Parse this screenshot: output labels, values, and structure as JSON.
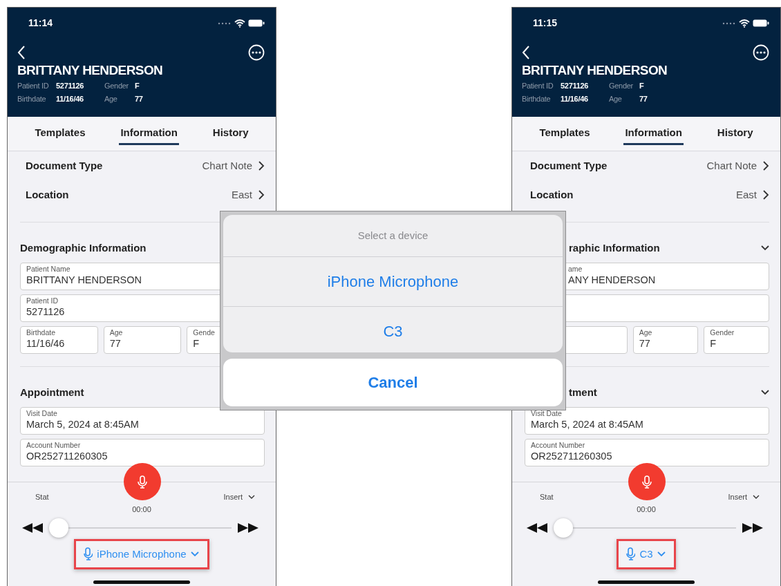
{
  "screens": [
    {
      "status_bar": {
        "time": "11:14"
      },
      "patient": {
        "name": "BRITTANY HENDERSON",
        "meta": [
          {
            "label": "Patient ID",
            "value": "5271126"
          },
          {
            "label": "Gender",
            "value": "F"
          },
          {
            "label": "Birthdate",
            "value": "11/16/46"
          },
          {
            "label": "Age",
            "value": "77"
          }
        ]
      },
      "tabs": [
        {
          "label": "Templates",
          "selected": false
        },
        {
          "label": "Information",
          "selected": true
        },
        {
          "label": "History",
          "selected": false
        }
      ],
      "settings": [
        {
          "label": "Document Type",
          "value": "Chart Note"
        },
        {
          "label": "Location",
          "value": "East"
        }
      ],
      "sections": [
        {
          "title": "Demographic Information",
          "rows": [
            [
              {
                "label": "Patient Name",
                "value": "BRITTANY HENDERSON"
              }
            ],
            [
              {
                "label": "Patient ID",
                "value": "5271126"
              }
            ],
            [
              {
                "label": "Birthdate",
                "value": "11/16/46"
              },
              {
                "label": "Age",
                "value": "77"
              },
              {
                "label": "Gende",
                "value": "F"
              }
            ]
          ]
        },
        {
          "title": "Appointment",
          "rows": [
            [
              {
                "label": "Visit Date",
                "value": "March 5, 2024 at 8:45AM"
              }
            ],
            [
              {
                "label": "Account Number",
                "value": "OR252711260305"
              }
            ]
          ]
        }
      ],
      "recorder": {
        "priority": "Stat",
        "mode": "Insert",
        "elapsed": "00:00",
        "level": 0,
        "device": "iPhone Microphone"
      }
    },
    {
      "status_bar": {
        "time": "11:15"
      },
      "patient": {
        "name": "BRITTANY HENDERSON",
        "meta": [
          {
            "label": "Patient ID",
            "value": "5271126"
          },
          {
            "label": "Gender",
            "value": "F"
          },
          {
            "label": "Birthdate",
            "value": "11/16/46"
          },
          {
            "label": "Age",
            "value": "77"
          }
        ]
      },
      "tabs": [
        {
          "label": "Templates",
          "selected": false
        },
        {
          "label": "Information",
          "selected": true
        },
        {
          "label": "History",
          "selected": false
        }
      ],
      "settings": [
        {
          "label": "Document Type",
          "value": "Chart Note"
        },
        {
          "label": "Location",
          "value": "East"
        }
      ],
      "sections": [
        {
          "title": "raphic Information",
          "covered": true,
          "expanded": true,
          "rows": [
            [
              {
                "label": "ame",
                "value": "ANY HENDERSON",
                "covered": true
              }
            ],
            [
              {
                "covered": true
              }
            ],
            [
              {
                "covered": true
              },
              {
                "label": "Age",
                "value": "77"
              },
              {
                "label": "Gender",
                "value": "F"
              }
            ]
          ]
        },
        {
          "title": "tment",
          "covered": true,
          "expanded": true,
          "rows": [
            [
              {
                "label": "Visit Date",
                "value": "March 5, 2024 at 8:45AM"
              }
            ],
            [
              {
                "label": "Account Number",
                "value": "OR252711260305"
              }
            ]
          ]
        }
      ],
      "recorder": {
        "priority": "Stat",
        "mode": "Insert",
        "elapsed": "00:00",
        "level": 0,
        "device": "C3"
      }
    }
  ],
  "action_sheet": {
    "title": "Select a device",
    "options": [
      {
        "label": "iPhone Microphone"
      },
      {
        "label": "C3"
      }
    ],
    "cancel": "Cancel"
  }
}
